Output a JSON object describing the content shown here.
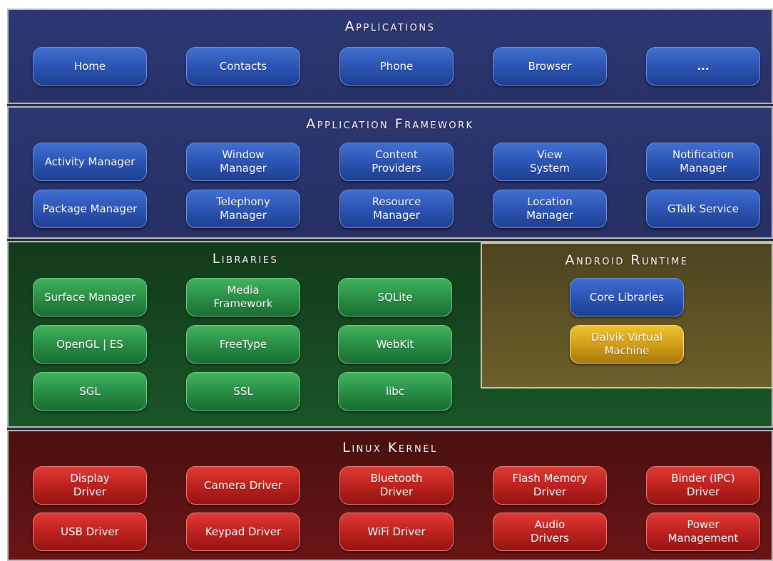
{
  "layers": {
    "applications": {
      "title": "Applications",
      "items": [
        "Home",
        "Contacts",
        "Phone",
        "Browser",
        "..."
      ]
    },
    "framework": {
      "title": "Application Framework",
      "items": [
        "Activity Manager",
        "Window\nManager",
        "Content\nProviders",
        "View\nSystem",
        "Notification\nManager",
        "Package Manager",
        "Telephony\nManager",
        "Resource\nManager",
        "Location\nManager",
        "GTalk Service"
      ]
    },
    "libraries": {
      "title": "Libraries",
      "items": [
        "Surface Manager",
        "Media\nFramework",
        "SQLite",
        "OpenGL | ES",
        "FreeType",
        "WebKit",
        "SGL",
        "SSL",
        "libc"
      ]
    },
    "runtime": {
      "title": "Android Runtime",
      "items": [
        "Core Libraries",
        "Dalvik Virtual\nMachine"
      ]
    },
    "kernel": {
      "title": "Linux Kernel",
      "items": [
        "Display\nDriver",
        "Camera Driver",
        "Bluetooth\nDriver",
        "Flash Memory\nDriver",
        "Binder (IPC)\nDriver",
        "USB Driver",
        "Keypad Driver",
        "WiFi Driver",
        "Audio\nDrivers",
        "Power\nManagement"
      ]
    }
  },
  "colors": {
    "applications_bg": "#2d3773",
    "framework_bg": "#2c3670",
    "libraries_bg": "#1a5526",
    "runtime_bg": "#6d5f29",
    "kernel_bg": "#6a1515",
    "blue_button": "#2d56b4",
    "green_button": "#2b9147",
    "red_button": "#bf2320",
    "gold_button": "#d4a11a"
  }
}
